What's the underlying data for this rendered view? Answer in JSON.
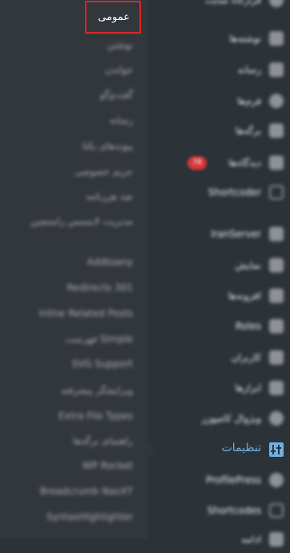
{
  "submenu": {
    "active_label": "عمومی",
    "items": [
      "نوشتن",
      "خواندن",
      "گفت‌وگو",
      "رسانه",
      "پیوندهای یکتا",
      "حریم خصوصی",
      "ضد هرزنامه",
      "مدیریت لایسنس راستچین",
      "Addtoany",
      "Redirects 301",
      "Inline Related Posts",
      "فهرست Simple",
      "SVG Support",
      "ویرایشگر پیشرفته",
      "Extra File Types",
      "راهنمای برگه‌ها",
      "WP Rocket",
      "Breadcrumb NavXT",
      "SyntaxHighlighter"
    ]
  },
  "mainmenu": {
    "top_partial": "قرارگاه سایت",
    "items": [
      {
        "label": "نوشته‌ها",
        "icon": "pin-icon"
      },
      {
        "label": "رسانه",
        "icon": "media-icon"
      },
      {
        "label": "فرم‌ها",
        "icon": "forms-icon"
      },
      {
        "label": "برگه‌ها",
        "icon": "pages-icon"
      },
      {
        "label": "دیدگاه‌ها",
        "icon": "comments-icon",
        "badge": "78"
      },
      {
        "label": "Shortcoder",
        "icon": "shortcode-icon"
      },
      {
        "label": "IranServer",
        "icon": "server-icon"
      },
      {
        "label": "نمایش",
        "icon": "appearance-icon"
      },
      {
        "label": "افزونه‌ها",
        "icon": "plugins-icon"
      },
      {
        "label": "Roles",
        "icon": "roles-icon"
      },
      {
        "label": "کاربران",
        "icon": "users-icon"
      },
      {
        "label": "ابزارها",
        "icon": "tools-icon"
      },
      {
        "label": "ویژوال کامپوزر",
        "icon": "composer-icon"
      }
    ],
    "active": {
      "label": "تنظیمات",
      "icon": "settings-icon"
    },
    "after": [
      {
        "label": "ProfilePress",
        "icon": "profile-icon"
      },
      {
        "label": "Shortcodes",
        "icon": "brackets-icon"
      },
      {
        "label": "ادامه",
        "icon": "more-icon"
      }
    ]
  },
  "colors": {
    "active_text": "#72aee6",
    "highlight_border": "#e02424",
    "badge": "#d63638",
    "submenu_bg": "#32373c",
    "menu_bg": "#2c3338"
  }
}
